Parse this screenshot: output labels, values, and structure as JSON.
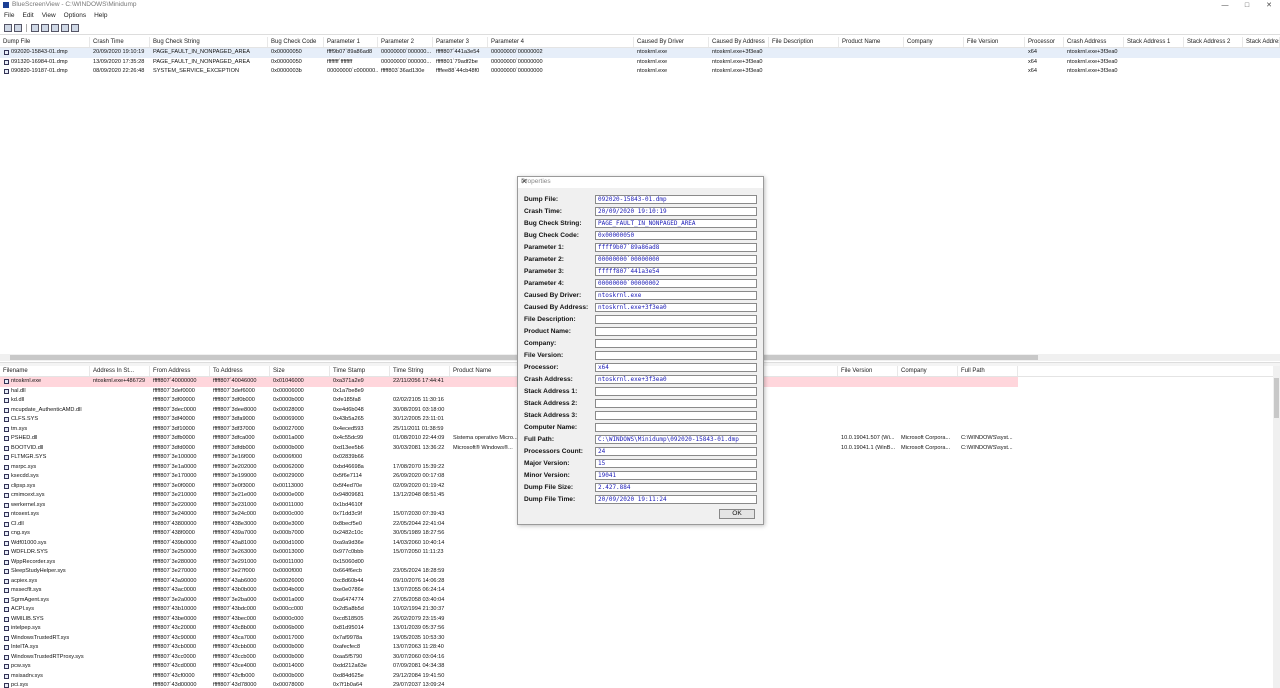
{
  "window": {
    "title": "BlueScreenView - C:\\WINDOWS\\Minidump"
  },
  "menu": [
    "File",
    "Edit",
    "View",
    "Options",
    "Help"
  ],
  "upper": {
    "columns": [
      "Dump File",
      "Crash Time",
      "Bug Check String",
      "Bug Check Code",
      "Parameter 1",
      "Parameter 2",
      "Parameter 3",
      "Parameter 4",
      "Caused By Driver",
      "Caused By Address",
      "File Description",
      "Product Name",
      "Company",
      "File Version",
      "Processor",
      "Crash Address",
      "Stack Address 1",
      "Stack Address 2",
      "Stack Address"
    ],
    "rows": [
      [
        "092020-15843-01.dmp",
        "20/09/2020 19:10:19",
        "PAGE_FAULT_IN_NONPAGED_AREA",
        "0x00000050",
        "ffff9b07`89a86ad8",
        "00000000`000000...",
        "fffff807`441a3e54",
        "00000000`00000002",
        "ntoskrnl.exe",
        "ntoskrnl.exe+3f3ea0",
        "",
        "",
        "",
        "",
        "x64",
        "ntoskrnl.exe+3f3ea0",
        "",
        "",
        ""
      ],
      [
        "091320-16984-01.dmp",
        "13/09/2020 17:35:28",
        "PAGE_FAULT_IN_NONPAGED_AREA",
        "0x00000050",
        "ffffffff`ffffffff",
        "00000000`000000...",
        "fffff801`79adf2be",
        "00000000`00000000",
        "ntoskrnl.exe",
        "ntoskrnl.exe+3f3ea0",
        "",
        "",
        "",
        "",
        "x64",
        "ntoskrnl.exe+3f3ea0",
        "",
        "",
        ""
      ],
      [
        "090820-19187-01.dmp",
        "08/09/2020 22:26:48",
        "SYSTEM_SERVICE_EXCEPTION",
        "0x0000003b",
        "00000000`c000000...",
        "fffff803`36ad130e",
        "ffffee88`44cb48f0",
        "00000000`00000000",
        "ntoskrnl.exe",
        "ntoskrnl.exe+3f3ea0",
        "",
        "",
        "",
        "",
        "x64",
        "ntoskrnl.exe+3f3ea0",
        "",
        "",
        ""
      ]
    ]
  },
  "lower": {
    "columns": [
      "Filename",
      "Address In St...",
      "From Address",
      "To Address",
      "Size",
      "Time Stamp",
      "Time String",
      "Product Name",
      "File Version",
      "Company",
      "Full Path"
    ],
    "rows": [
      [
        "ntoskrnl.exe",
        "ntoskrnl.exe+486729",
        "fffff807`40000000",
        "fffff807`40046000",
        "0x01046000",
        "0xa371a2e9",
        "22/11/2056 17:44:41",
        "",
        "",
        "",
        ""
      ],
      [
        "hal.dll",
        "",
        "fffff807`3def0000",
        "fffff807`3def6000",
        "0x00006000",
        "0x1a7be8e9",
        "",
        "",
        "",
        "",
        ""
      ],
      [
        "kd.dll",
        "",
        "fffff807`3df00000",
        "fffff807`3df0b000",
        "0x0000b000",
        "0xfe185fa8",
        "02/02/2105 11:30:16",
        "",
        "",
        "",
        ""
      ],
      [
        "mcupdate_AuthenticAMD.dll",
        "",
        "fffff807`3dec0000",
        "fffff807`3dee8000",
        "0x00028000",
        "0xe4d6b048",
        "30/08/2091 03:18:00",
        "",
        "",
        "",
        ""
      ],
      [
        "CLFS.SYS",
        "",
        "fffff807`3df40000",
        "fffff807`3dfa9000",
        "0x00069000",
        "0x43b5a265",
        "30/12/2005 23:11:01",
        "",
        "",
        "",
        ""
      ],
      [
        "tm.sys",
        "",
        "fffff807`3df10000",
        "fffff807`3df37000",
        "0x00027000",
        "0x4eced593",
        "25/11/2011 01:38:59",
        "",
        "",
        "",
        ""
      ],
      [
        "PSHED.dll",
        "",
        "fffff807`3dfb0000",
        "fffff807`3dfca000",
        "0x0001a000",
        "0x4c55dc99",
        "01/08/2010 22:44:09",
        "Sistema operativo Micro...",
        "10.0.19041.507 (Wi...",
        "Microsoft Corpora...",
        "C:\\WINDOWS\\syst..."
      ],
      [
        "BOOTVID.dll",
        "",
        "fffff807`3dfd0000",
        "fffff807`3dfdb000",
        "0x0000b000",
        "0xd13ee5b6",
        "30/03/2081 13:36:22",
        "Microsoft® Windows®...",
        "10.0.19041.1 (WinB...",
        "Microsoft Corpora...",
        "C:\\WINDOWS\\syst..."
      ],
      [
        "FLTMGR.SYS",
        "",
        "fffff807`3e100000",
        "fffff807`3e16f000",
        "0x0006f000",
        "0x02839b66",
        "",
        "",
        "",
        "",
        ""
      ],
      [
        "msrpc.sys",
        "",
        "fffff807`3e1a0000",
        "fffff807`3e202000",
        "0x00062000",
        "0xbd46698a",
        "17/08/2070 15:39:22",
        "",
        "",
        "",
        ""
      ],
      [
        "ksecdd.sys",
        "",
        "fffff807`3e170000",
        "fffff807`3e199000",
        "0x00029000",
        "0x5f6e7114",
        "26/09/2020 00:17:08",
        "",
        "",
        "",
        ""
      ],
      [
        "clipsp.sys",
        "",
        "fffff807`3e0f0000",
        "fffff807`3e0f3000",
        "0x00113000",
        "0x5f4ed70e",
        "02/09/2020 01:19:42",
        "",
        "",
        "",
        ""
      ],
      [
        "cmimcext.sys",
        "",
        "fffff807`3e210000",
        "fffff807`3e21e000",
        "0x0000e000",
        "0x94809681",
        "13/12/2048 08:51:45",
        "",
        "",
        "",
        ""
      ],
      [
        "werkernel.sys",
        "",
        "fffff807`3e220000",
        "fffff807`3e231000",
        "0x00011000",
        "0x1bd4610f",
        "",
        "",
        "",
        "",
        ""
      ],
      [
        "ntosext.sys",
        "",
        "fffff807`3e240000",
        "fffff807`3e24c000",
        "0x0000c000",
        "0x71dd3c9f",
        "15/07/2030 07:39:43",
        "",
        "",
        "",
        ""
      ],
      [
        "CI.dll",
        "",
        "fffff807`43800000",
        "fffff807`438e3000",
        "0x000e3000",
        "0x8becf5e0",
        "22/05/2044 22:41:04",
        "",
        "",
        "",
        ""
      ],
      [
        "cng.sys",
        "",
        "fffff807`438f0000",
        "fffff807`439a7000",
        "0x000b7000",
        "0x2482c10c",
        "30/05/1989 18:27:56",
        "",
        "",
        "",
        ""
      ],
      [
        "Wdf01000.sys",
        "",
        "fffff807`439b0000",
        "fffff807`43a81000",
        "0x000d1000",
        "0xa9a9d36e",
        "14/03/2060 10:40:14",
        "",
        "",
        "",
        ""
      ],
      [
        "WDFLDR.SYS",
        "",
        "fffff807`3e250000",
        "fffff807`3e263000",
        "0x00013000",
        "0x977c0bbb",
        "15/07/2050 11:11:23",
        "",
        "",
        "",
        ""
      ],
      [
        "WppRecorder.sys",
        "",
        "fffff807`3e280000",
        "fffff807`3e291000",
        "0x00011000",
        "0x15060d00",
        "",
        "",
        "",
        "",
        ""
      ],
      [
        "SleepStudyHelper.sys",
        "",
        "fffff807`3e270000",
        "fffff807`3e27f000",
        "0x0000f000",
        "0x664f6ecb",
        "23/05/2024 18:28:59",
        "",
        "",
        "",
        ""
      ],
      [
        "acpiex.sys",
        "",
        "fffff807`43a90000",
        "fffff807`43ab6000",
        "0x00026000",
        "0xc8d60b44",
        "09/10/2076 14:06:28",
        "",
        "",
        "",
        ""
      ],
      [
        "mssecflt.sys",
        "",
        "fffff807`43ac0000",
        "fffff807`43b0b000",
        "0x0004b000",
        "0xe0e0786e",
        "13/07/2055 06:24:14",
        "",
        "",
        "",
        ""
      ],
      [
        "SgrmAgent.sys",
        "",
        "fffff807`3e2a0000",
        "fffff807`3e2ba000",
        "0x0001a000",
        "0xa6474774",
        "27/05/2058 03:40:04",
        "",
        "",
        "",
        ""
      ],
      [
        "ACPI.sys",
        "",
        "fffff807`43b10000",
        "fffff807`43bdc000",
        "0x000cc000",
        "0x2d5a8b5d",
        "10/02/1994 21:30:37",
        "",
        "",
        "",
        ""
      ],
      [
        "WMILIB.SYS",
        "",
        "fffff807`43be0000",
        "fffff807`43bec000",
        "0x0000c000",
        "0xcd518505",
        "26/02/2079 23:15:49",
        "",
        "",
        "",
        ""
      ],
      [
        "intelpep.sys",
        "",
        "fffff807`43c20000",
        "fffff807`43c8b000",
        "0x0006b000",
        "0x81d95014",
        "13/01/2039 05:37:56",
        "",
        "",
        "",
        ""
      ],
      [
        "WindowsTrustedRT.sys",
        "",
        "fffff807`43c90000",
        "fffff807`43ca7000",
        "0x00017000",
        "0x7af9978a",
        "19/05/2035 10:53:30",
        "",
        "",
        "",
        ""
      ],
      [
        "IntelTA.sys",
        "",
        "fffff807`43cb0000",
        "fffff807`43cbb000",
        "0x0000b000",
        "0xafecfec8",
        "13/07/2063 11:28:40",
        "",
        "",
        "",
        ""
      ],
      [
        "WindowsTrustedRTProxy.sys",
        "",
        "fffff807`43cc0000",
        "fffff807`43ccb000",
        "0x0000b000",
        "0xaa5f5790",
        "30/07/2060 03:04:16",
        "",
        "",
        "",
        ""
      ],
      [
        "pcw.sys",
        "",
        "fffff807`43cd0000",
        "fffff807`43ce4000",
        "0x00014000",
        "0xdd212a63e",
        "07/09/2081 04:34:38",
        "",
        "",
        "",
        ""
      ],
      [
        "msisadrv.sys",
        "",
        "fffff807`43cf0000",
        "fffff807`43cfb000",
        "0x0000b000",
        "0xd84d625e",
        "29/12/2084 19:41:50",
        "",
        "",
        "",
        ""
      ],
      [
        "pci.sys",
        "",
        "fffff807`43d00000",
        "fffff807`43d78000",
        "0x00078000",
        "0x7f1b0a64",
        "29/07/2037 13:09:24",
        "",
        "",
        "",
        ""
      ]
    ]
  },
  "dialog": {
    "title": "Properties",
    "close": "✕",
    "ok": "OK",
    "fields": [
      {
        "label": "Dump File:",
        "value": "092020-15843-01.dmp"
      },
      {
        "label": "Crash Time:",
        "value": "20/09/2020 19:10:19"
      },
      {
        "label": "Bug Check String:",
        "value": "PAGE_FAULT_IN_NONPAGED_AREA"
      },
      {
        "label": "Bug Check Code:",
        "value": "0x00000050"
      },
      {
        "label": "Parameter 1:",
        "value": "ffff9b07`89a86ad8"
      },
      {
        "label": "Parameter 2:",
        "value": "00000000`00000000"
      },
      {
        "label": "Parameter 3:",
        "value": "fffff807`441a3e54"
      },
      {
        "label": "Parameter 4:",
        "value": "00000000`00000002"
      },
      {
        "label": "Caused By Driver:",
        "value": "ntoskrnl.exe"
      },
      {
        "label": "Caused By Address:",
        "value": "ntoskrnl.exe+3f3ea0"
      },
      {
        "label": "File Description:",
        "value": ""
      },
      {
        "label": "Product Name:",
        "value": ""
      },
      {
        "label": "Company:",
        "value": ""
      },
      {
        "label": "File Version:",
        "value": ""
      },
      {
        "label": "Processor:",
        "value": "x64"
      },
      {
        "label": "Crash Address:",
        "value": "ntoskrnl.exe+3f3ea0"
      },
      {
        "label": "Stack Address 1:",
        "value": ""
      },
      {
        "label": "Stack Address 2:",
        "value": ""
      },
      {
        "label": "Stack Address 3:",
        "value": ""
      },
      {
        "label": "Computer Name:",
        "value": ""
      },
      {
        "label": "Full Path:",
        "value": "C:\\WINDOWS\\Minidump\\092020-15843-01.dmp"
      },
      {
        "label": "Processors Count:",
        "value": "24"
      },
      {
        "label": "Major Version:",
        "value": "15"
      },
      {
        "label": "Minor Version:",
        "value": "19041"
      },
      {
        "label": "Dump File Size:",
        "value": "2.427.884"
      },
      {
        "label": "Dump File Time:",
        "value": "20/09/2020 19:11:24"
      }
    ]
  },
  "icons": {
    "app": "bluescreen-app-icon",
    "dump": "dump-file-icon",
    "module": "module-file-icon"
  },
  "colors": {
    "highlight_row": "#ffd6dc",
    "selected_row": "#e6eef9",
    "value_text": "#1b1bb8"
  }
}
